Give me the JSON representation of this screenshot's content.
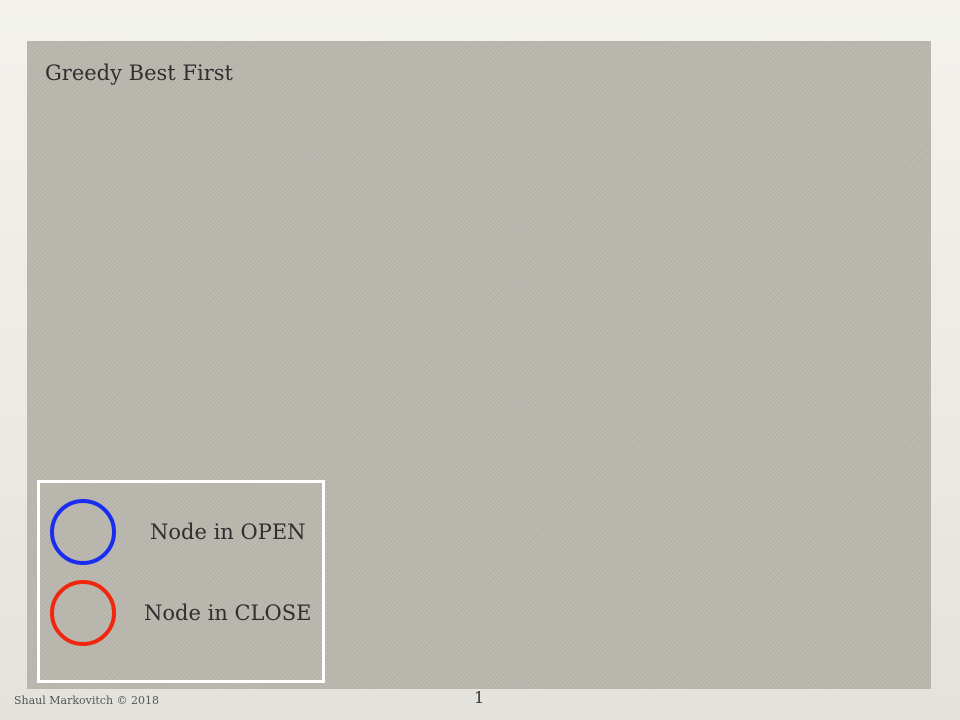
{
  "slide": {
    "title": "Greedy Best First",
    "panel_color": "#bab7af"
  },
  "legend": {
    "items": [
      {
        "label": "Node in OPEN",
        "color": "#1a2cf0",
        "icon": "circle-outline-icon"
      },
      {
        "label": "Node in CLOSE",
        "color": "#f0260f",
        "icon": "circle-outline-icon"
      }
    ]
  },
  "footer": {
    "credit": "Shaul Markovitch © 2018",
    "page_number": "1"
  }
}
